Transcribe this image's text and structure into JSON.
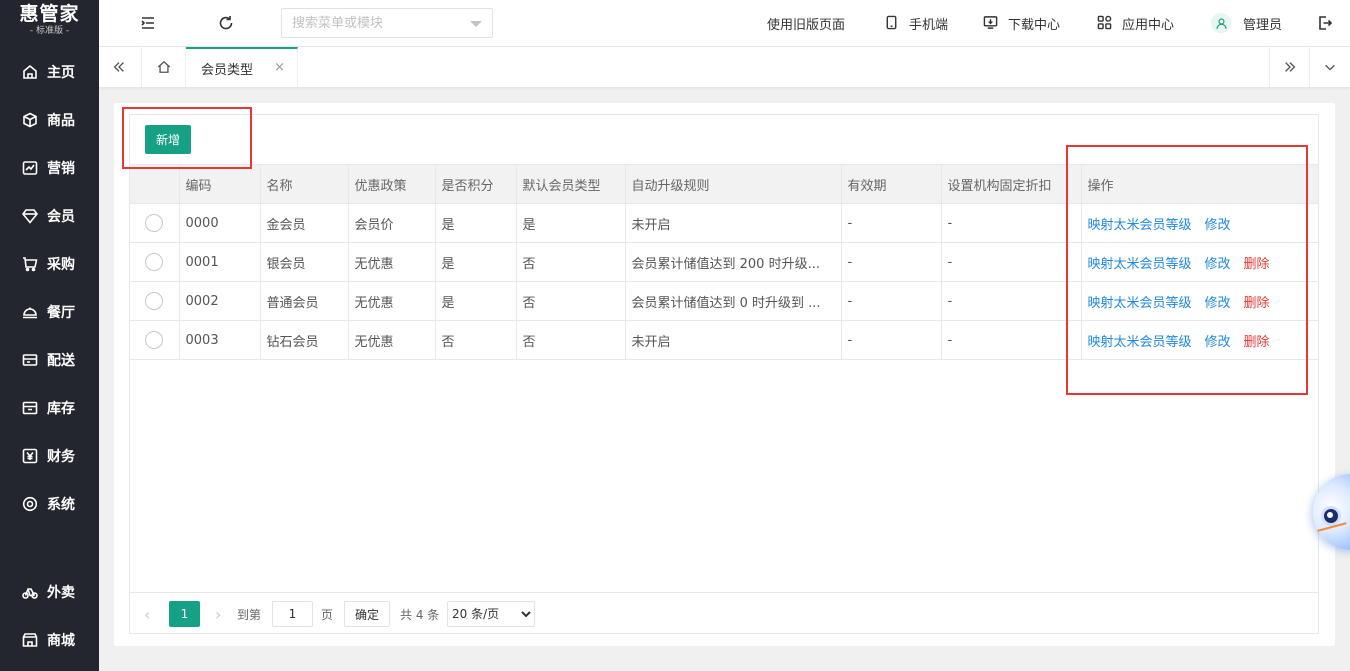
{
  "brand": {
    "name": "惠管家",
    "edition": "- 标准版 -"
  },
  "sidebar": {
    "items": [
      {
        "label": "主页",
        "icon": "home-icon"
      },
      {
        "label": "商品",
        "icon": "box-icon"
      },
      {
        "label": "营销",
        "icon": "chart-icon"
      },
      {
        "label": "会员",
        "icon": "diamond-icon"
      },
      {
        "label": "采购",
        "icon": "cart-icon"
      },
      {
        "label": "餐厅",
        "icon": "dish-icon"
      },
      {
        "label": "配送",
        "icon": "truck-icon"
      },
      {
        "label": "库存",
        "icon": "inventory-icon"
      },
      {
        "label": "财务",
        "icon": "yen-icon"
      },
      {
        "label": "系统",
        "icon": "settings-icon"
      },
      {
        "label": "外卖",
        "icon": "bike-icon"
      },
      {
        "label": "商城",
        "icon": "store-icon"
      }
    ]
  },
  "header": {
    "search_placeholder": "搜索菜单或模块",
    "old_version": "使用旧版页面",
    "mobile": "手机端",
    "download": "下载中心",
    "apps": "应用中心",
    "user": "管理员"
  },
  "tabs": {
    "active": "会员类型",
    "close": "×"
  },
  "toolbar": {
    "add_label": "新增"
  },
  "table": {
    "columns": [
      "编码",
      "名称",
      "优惠政策",
      "是否积分",
      "默认会员类型",
      "自动升级规则",
      "有效期",
      "设置机构固定折扣",
      "操作"
    ],
    "rows": [
      {
        "code": "0000",
        "name": "金会员",
        "policy": "会员价",
        "points": "是",
        "default": "是",
        "rule": "未开启",
        "validity": "-",
        "discount": "-",
        "ops": [
          "映射太米会员等级",
          "修改"
        ]
      },
      {
        "code": "0001",
        "name": "银会员",
        "policy": "无优惠",
        "points": "是",
        "default": "否",
        "rule": "会员累计储值达到 200 时升级...",
        "validity": "-",
        "discount": "-",
        "ops": [
          "映射太米会员等级",
          "修改",
          "删除"
        ]
      },
      {
        "code": "0002",
        "name": "普通会员",
        "policy": "无优惠",
        "points": "是",
        "default": "否",
        "rule": "会员累计储值达到 0 时升级到 ...",
        "validity": "-",
        "discount": "-",
        "ops": [
          "映射太米会员等级",
          "修改",
          "删除"
        ]
      },
      {
        "code": "0003",
        "name": "钻石会员",
        "policy": "无优惠",
        "points": "否",
        "default": "否",
        "rule": "未开启",
        "validity": "-",
        "discount": "-",
        "ops": [
          "映射太米会员等级",
          "修改",
          "删除"
        ]
      }
    ]
  },
  "pagination": {
    "current": "1",
    "goto_label": "到第",
    "goto_value": "1",
    "page_unit": "页",
    "confirm": "确定",
    "total": "共 4 条",
    "page_size": "20 条/页"
  },
  "colors": {
    "accent": "#16a085",
    "sidebar": "#23262e",
    "link": "#1e88e5",
    "danger": "#e53935"
  }
}
